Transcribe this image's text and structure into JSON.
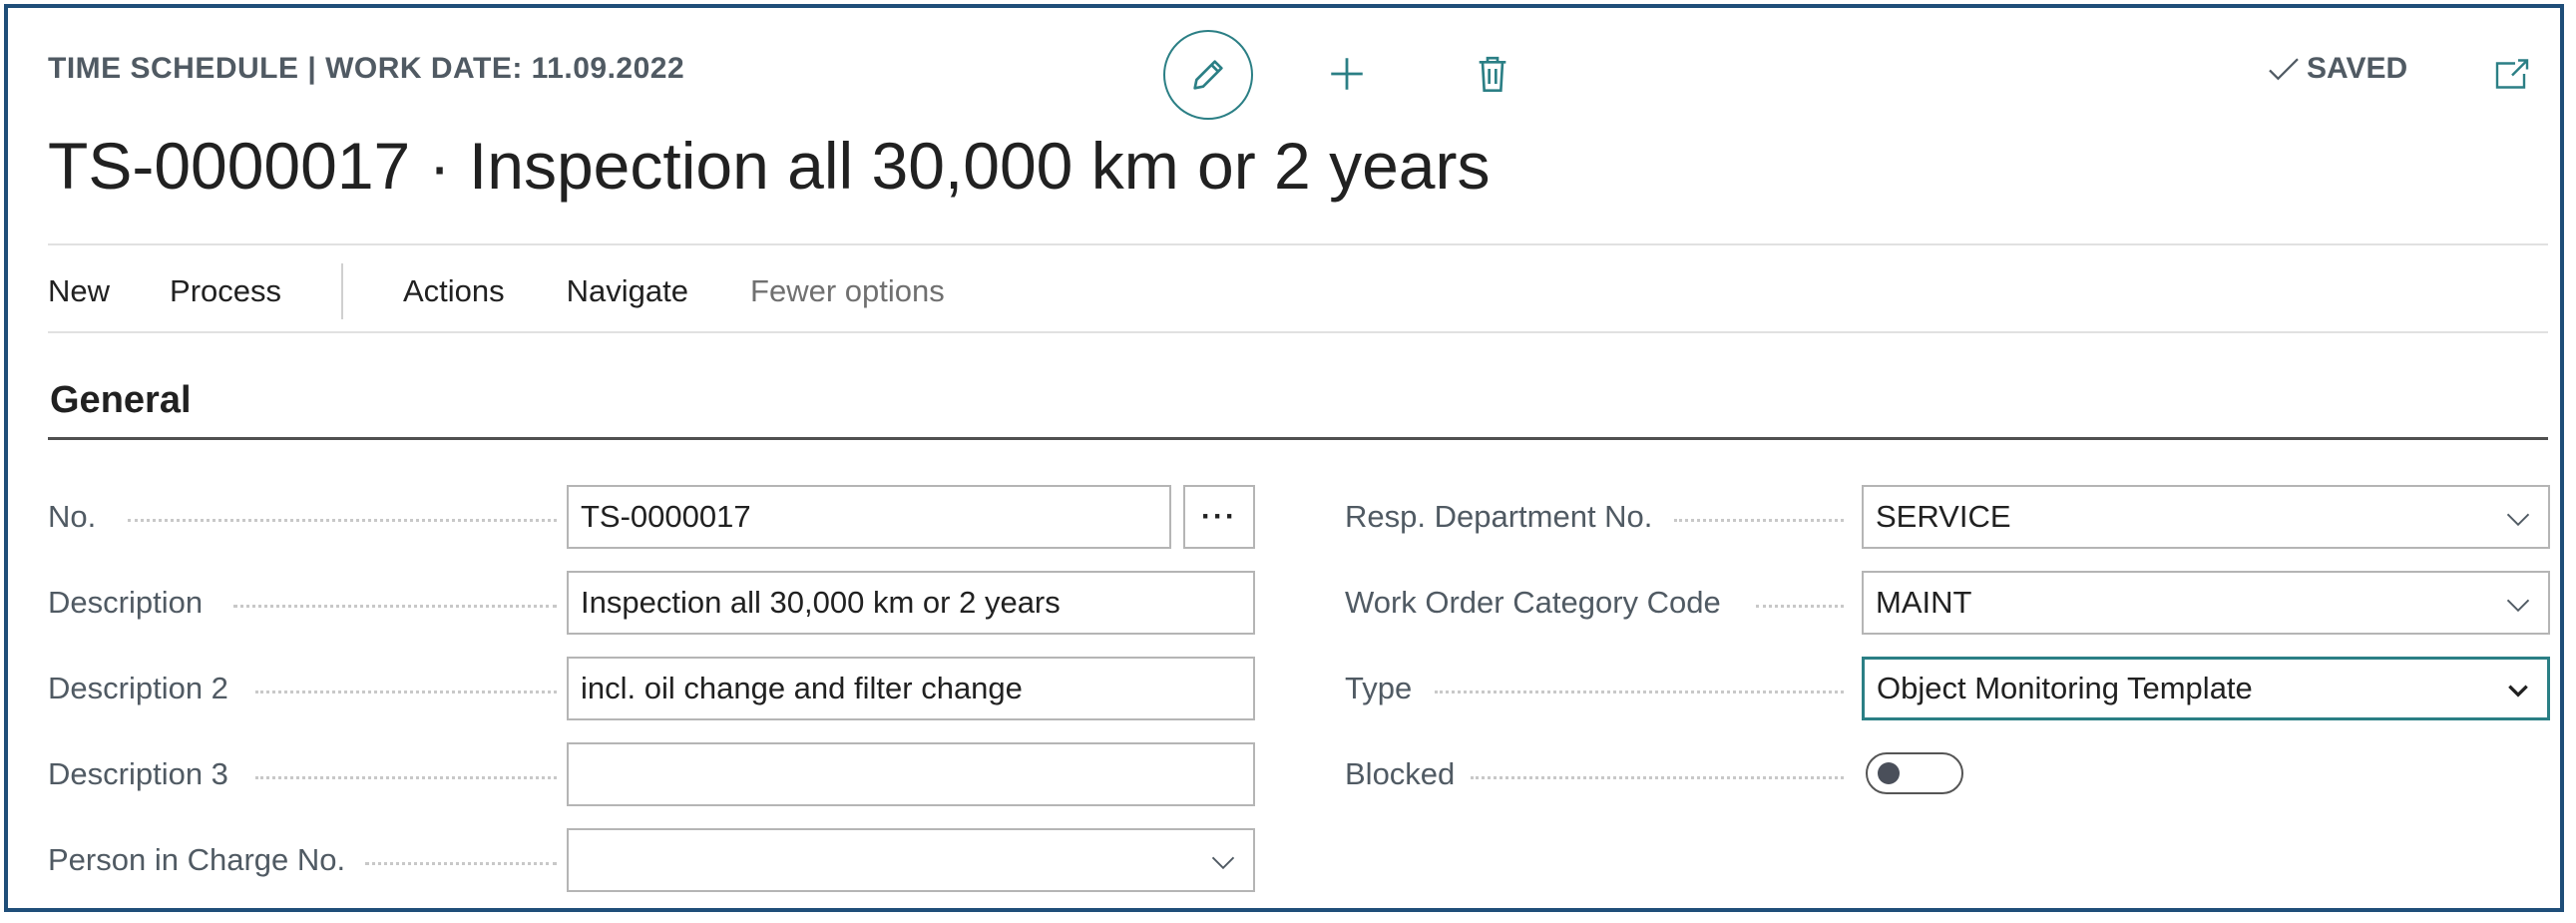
{
  "header": {
    "breadcrumb": "TIME SCHEDULE | WORK DATE: 11.09.2022",
    "title": "TS-0000017 · Inspection all 30,000 km or 2 years",
    "status": "SAVED",
    "icons": [
      "pencil-icon",
      "plus-icon",
      "trash-icon",
      "check-icon",
      "popout-icon"
    ]
  },
  "actions": {
    "new": "New",
    "process": "Process",
    "actions": "Actions",
    "navigate": "Navigate",
    "fewer": "Fewer options"
  },
  "section": {
    "title": "General"
  },
  "fields": {
    "no": {
      "label": "No.",
      "value": "TS-0000017",
      "assist": "···"
    },
    "description": {
      "label": "Description",
      "value": "Inspection all 30,000 km or 2 years"
    },
    "description2": {
      "label": "Description 2",
      "value": "incl. oil change and filter change"
    },
    "description3": {
      "label": "Description 3",
      "value": ""
    },
    "person_in_charge": {
      "label": "Person in Charge No.",
      "value": ""
    },
    "resp_department": {
      "label": "Resp. Department No.",
      "value": "SERVICE"
    },
    "work_order_category": {
      "label": "Work Order Category Code",
      "value": "MAINT"
    },
    "type": {
      "label": "Type",
      "value": "Object Monitoring Template"
    },
    "blocked": {
      "label": "Blocked",
      "value": false
    }
  },
  "colors": {
    "accent": "#2b7f85",
    "frame": "#1f4e79",
    "label": "#505a63"
  }
}
